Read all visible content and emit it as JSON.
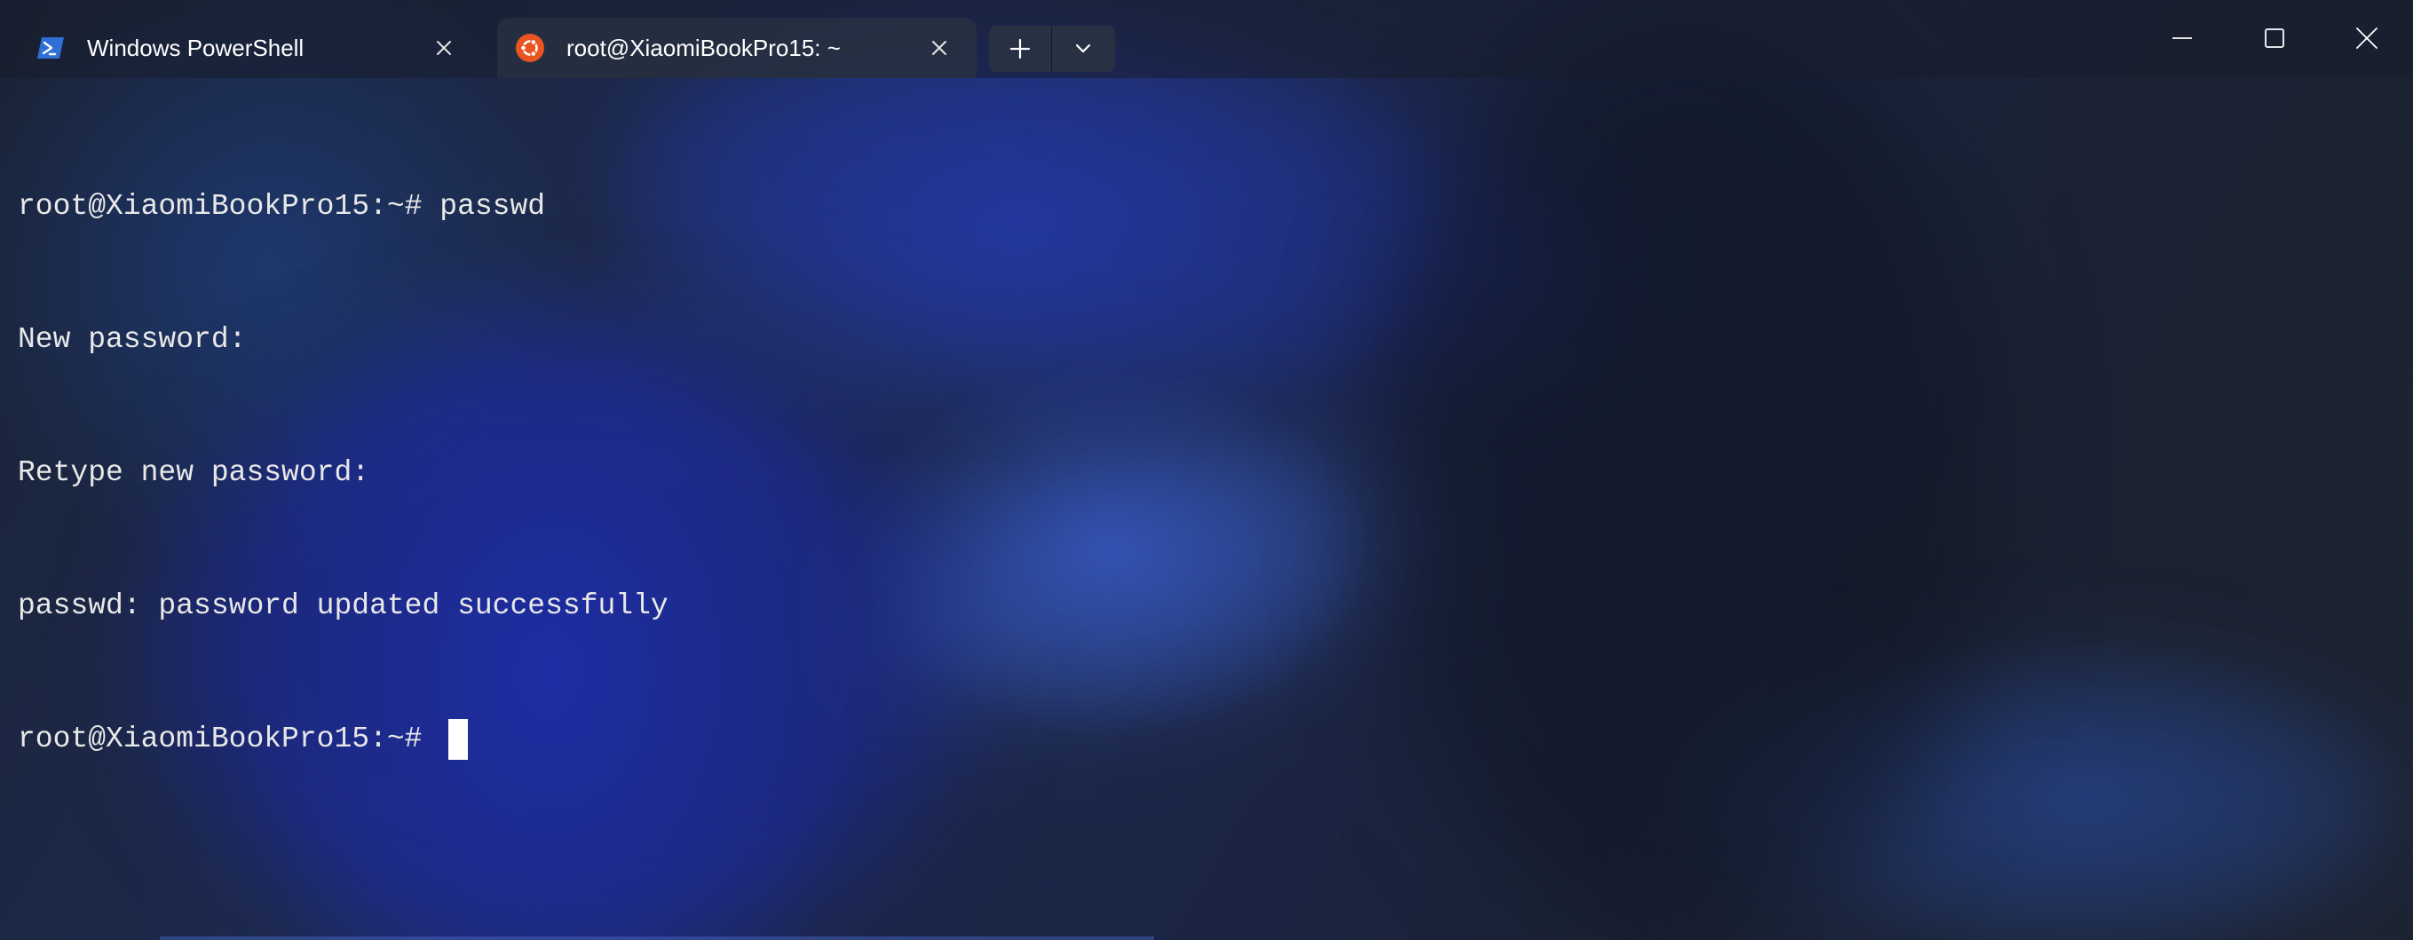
{
  "window": {
    "accent_color": "#2b3fae",
    "background": "blue abstract swirl wallpaper"
  },
  "tabs": [
    {
      "title": "Windows PowerShell",
      "icon": "powershell-icon",
      "active": false
    },
    {
      "title": "root@XiaomiBookPro15: ~",
      "icon": "ubuntu-icon",
      "active": true
    }
  ],
  "titlebar": {
    "new_tab_icon": "plus-icon",
    "dropdown_icon": "chevron-down-icon",
    "minimize_icon": "minimize-icon",
    "maximize_icon": "maximize-icon",
    "close_icon": "close-icon"
  },
  "terminal": {
    "lines": [
      "root@XiaomiBookPro15:~# passwd",
      "New password:",
      "Retype new password:",
      "passwd: password updated successfully"
    ],
    "prompt": "root@XiaomiBookPro15:~# "
  }
}
